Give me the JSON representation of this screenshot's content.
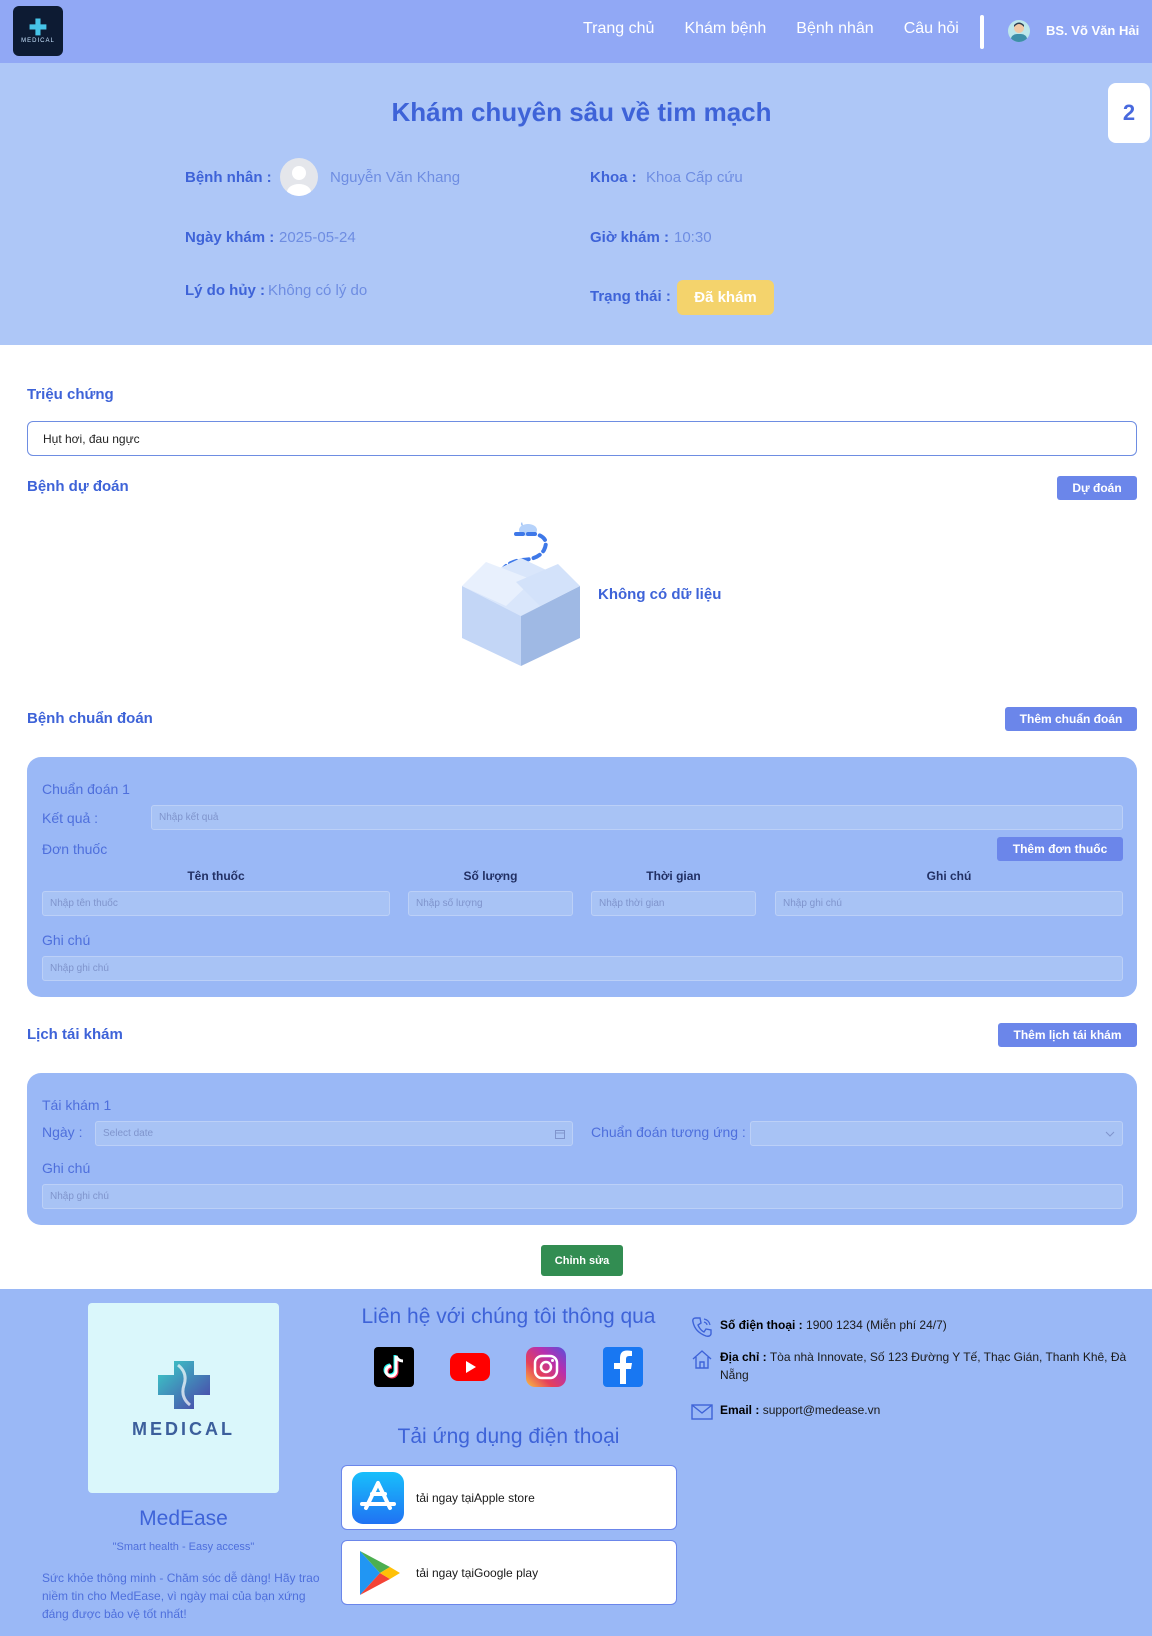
{
  "nav": {
    "logo_text": "MEDICAL",
    "links": [
      "Trang chủ",
      "Khám bệnh",
      "Bệnh nhân",
      "Câu hỏi"
    ],
    "user_name": "BS. Võ Văn Hải"
  },
  "header": {
    "title": "Khám chuyên sâu về tim mạch",
    "badge": "2",
    "patient_label": "Bệnh nhân :",
    "patient_value": "Nguyễn Văn Khang",
    "department_label": "Khoa :",
    "department_value": "Khoa Cấp cứu",
    "date_label": "Ngày khám :",
    "date_value": "2025-05-24",
    "time_label": "Giờ khám :",
    "time_value": "10:30",
    "cancel_label": "Lý do hủy :",
    "cancel_value": "Không có lý do",
    "status_label": "Trạng thái :",
    "status_value": "Đã khám",
    "status_color": "#f4d36c"
  },
  "symptoms": {
    "title": "Triệu chứng",
    "value": "Hụt hơi, đau ngực"
  },
  "predicted": {
    "title": "Bệnh dự đoán",
    "button": "Dự đoán",
    "empty_text": "Không có dữ liệu"
  },
  "diagnosis": {
    "title": "Bệnh chuẩn đoán",
    "add_button": "Thêm chuẩn đoán",
    "card_title": "Chuẩn đoán 1",
    "result_label": "Kết quả :",
    "result_placeholder": "Nhập kết quả",
    "prescription_label": "Đơn thuốc",
    "add_prescription_button": "Thêm đơn thuốc",
    "columns": [
      "Tên thuốc",
      "Số lượng",
      "Thời gian",
      "Ghi chú"
    ],
    "placeholders": [
      "Nhập tên thuốc",
      "Nhập số lượng",
      "Nhập thời gian",
      "Nhập ghi chú"
    ],
    "note_label": "Ghi chú",
    "note_placeholder": "Nhập ghi chú"
  },
  "followup": {
    "title": "Lịch tái khám",
    "add_button": "Thêm lịch tái khám",
    "card_title": "Tái khám 1",
    "date_label": "Ngày :",
    "date_placeholder": "Select date",
    "diagnosis_label": "Chuẩn đoán tương ứng :",
    "note_label": "Ghi chú",
    "note_placeholder": "Nhập ghi chú"
  },
  "edit_button": "Chỉnh sửa",
  "footer": {
    "logo_text": "MEDICAL",
    "brand": "MedEase",
    "slogan": "\"Smart health - Easy access\"",
    "description": "Sức khỏe thông minh - Chăm sóc dễ dàng! Hãy trao niềm tin cho MedEase, vì ngày mai của bạn xứng đáng được bảo vệ tốt nhất!",
    "contact_heading": "Liên hệ với chúng tôi thông qua",
    "socials": [
      "tiktok-icon",
      "youtube-icon",
      "instagram-icon",
      "facebook-icon"
    ],
    "app_heading": "Tải ứng dụng điện thoại",
    "apple_text": "tải ngay tạiApple store",
    "google_text": "tải ngay tạiGoogle play",
    "phone_label": "Số điện thoại :",
    "phone_value": "1900 1234 (Miễn phí 24/7)",
    "address_label": "Địa chỉ :",
    "address_value": "Tòa nhà Innovate, Số 123 Đường Y Tế, Thạc Gián, Thanh Khê, Đà Nẵng",
    "email_label": "Email :",
    "email_value": "support@medease.vn"
  },
  "colors": {
    "nav_bg": "#91a8f5",
    "header_bg": "#aec7f7",
    "accent": "#3e63d8",
    "button": "#6b86ea",
    "card_bg": "#9ab8f6",
    "edit_button": "#328d52"
  }
}
